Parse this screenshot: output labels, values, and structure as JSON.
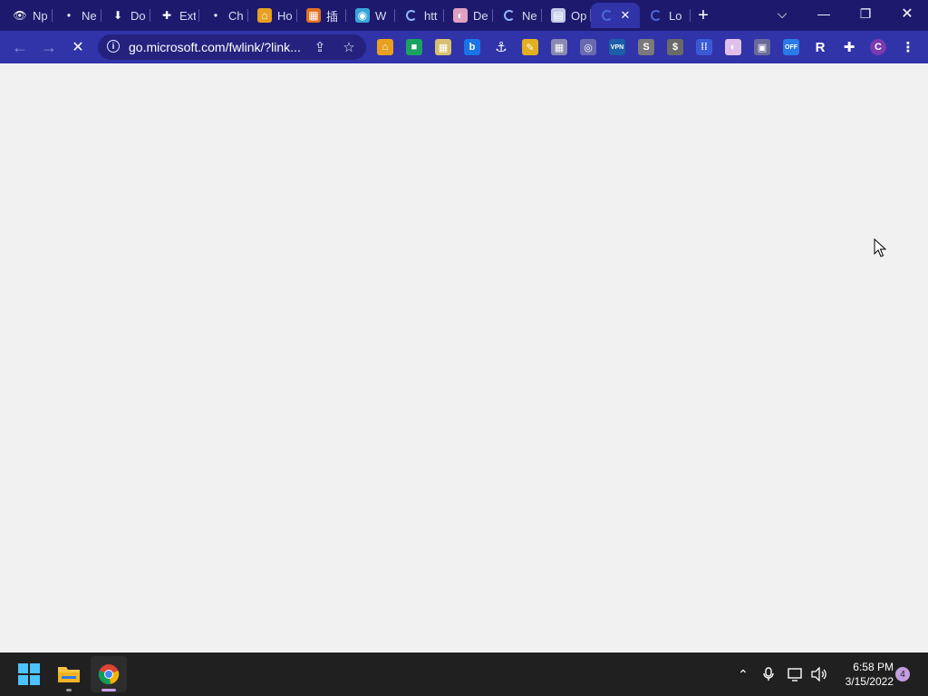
{
  "browser": {
    "tabs": [
      {
        "label": "Np",
        "icon": "eye-icon",
        "fav_glyph": "👁",
        "fav_color": "#1d1a6e"
      },
      {
        "label": "Ne",
        "icon": "dot-icon",
        "fav_glyph": "•",
        "fav_color": "#1d1a6e"
      },
      {
        "label": "Do",
        "icon": "download-icon",
        "fav_glyph": "⬇",
        "fav_color": "#1d1a6e"
      },
      {
        "label": "Ext",
        "icon": "puzzle-icon",
        "fav_glyph": "✚",
        "fav_color": "#1d1a6e"
      },
      {
        "label": "Ch",
        "icon": "dot-icon",
        "fav_glyph": "•",
        "fav_color": "#1d1a6e"
      },
      {
        "label": "Ho",
        "icon": "home-icon",
        "fav_glyph": "⌂",
        "fav_color": "#e8a020"
      },
      {
        "label": "插",
        "icon": "app-icon",
        "fav_glyph": "▦",
        "fav_color": "#e07020"
      },
      {
        "label": "W",
        "icon": "globe-icon",
        "fav_glyph": "◉",
        "fav_color": "#3aa6d8"
      },
      {
        "label": "htt",
        "icon": "loading-icon",
        "fav_glyph": "",
        "fav_color": "spinner"
      },
      {
        "label": "De",
        "icon": "flag-icon",
        "fav_glyph": "◐",
        "fav_color": "#e0a0c0"
      },
      {
        "label": "Ne",
        "icon": "loading-icon",
        "fav_glyph": "",
        "fav_color": "spinner"
      },
      {
        "label": "Op",
        "icon": "document-icon",
        "fav_glyph": "▤",
        "fav_color": "#c0c8e8"
      }
    ],
    "active_tab": {
      "label": "",
      "close_glyph": "✕"
    },
    "last_tab": {
      "label": "Lo"
    },
    "new_tab_glyph": "+",
    "window_controls": {
      "tab_search": "⌵",
      "minimize": "—",
      "restore": "❐",
      "close": "✕"
    },
    "nav": {
      "back": "←",
      "forward": "→",
      "stop": "✕"
    },
    "address": {
      "url": "go.microsoft.com/fwlink/?link...",
      "info_glyph": "i",
      "share_glyph": "⇪",
      "star_glyph": "☆"
    },
    "extensions": [
      {
        "name": "home-extension-icon",
        "glyph": "⌂",
        "color": "#e8a020"
      },
      {
        "name": "meet-extension-icon",
        "glyph": "■",
        "color": "#1aa260"
      },
      {
        "name": "grid-extension-icon",
        "glyph": "▦",
        "color": "#d8c070"
      },
      {
        "name": "b-extension-icon",
        "glyph": "b",
        "color": "#1a73e8"
      },
      {
        "name": "anchor-extension-icon",
        "glyph": "⚓",
        "color": "#3133a8"
      },
      {
        "name": "pencil-extension-icon",
        "glyph": "✎",
        "color": "#e0b020"
      },
      {
        "name": "tiles-extension-icon",
        "glyph": "▦",
        "color": "#8a8ab0"
      },
      {
        "name": "fingerprint-extension-icon",
        "glyph": "◎",
        "color": "#6a6ab0"
      },
      {
        "name": "vpn-extension-icon",
        "glyph": "VPN",
        "color": "#1a5fa8"
      },
      {
        "name": "s-extension-icon",
        "glyph": "S",
        "color": "#7a7a7a"
      },
      {
        "name": "dollar-extension-icon",
        "glyph": "$",
        "color": "#6a6a6a"
      },
      {
        "name": "board-extension-icon",
        "glyph": "⁞⁞",
        "color": "#3a5ad8"
      },
      {
        "name": "circle-extension-icon",
        "glyph": "◐",
        "color": "#e0c0e8"
      },
      {
        "name": "image-extension-icon",
        "glyph": "▣",
        "color": "#6a6a9a"
      },
      {
        "name": "off-extension-icon",
        "glyph": "OFF",
        "color": "#2a7ae8"
      },
      {
        "name": "r-extension-icon",
        "glyph": "R",
        "color": "#3133a8"
      },
      {
        "name": "extensions-puzzle-icon",
        "glyph": "✚",
        "color": "#3133a8"
      },
      {
        "name": "profile-avatar",
        "glyph": "C",
        "color": "#7a3ab0"
      },
      {
        "name": "menu-kebab-icon",
        "glyph": "⋮",
        "color": "#3133a8"
      }
    ]
  },
  "taskbar": {
    "apps": [
      {
        "name": "start-button",
        "icon": "windows-icon"
      },
      {
        "name": "file-explorer",
        "icon": "folder-icon"
      },
      {
        "name": "chrome",
        "icon": "chrome-icon"
      }
    ],
    "tray": {
      "chevron": "⌃",
      "mic": "🎙",
      "network": "▭",
      "volume": "🔊"
    },
    "clock": {
      "time": "6:58 PM",
      "date": "3/15/2022"
    },
    "notification_count": "4"
  }
}
